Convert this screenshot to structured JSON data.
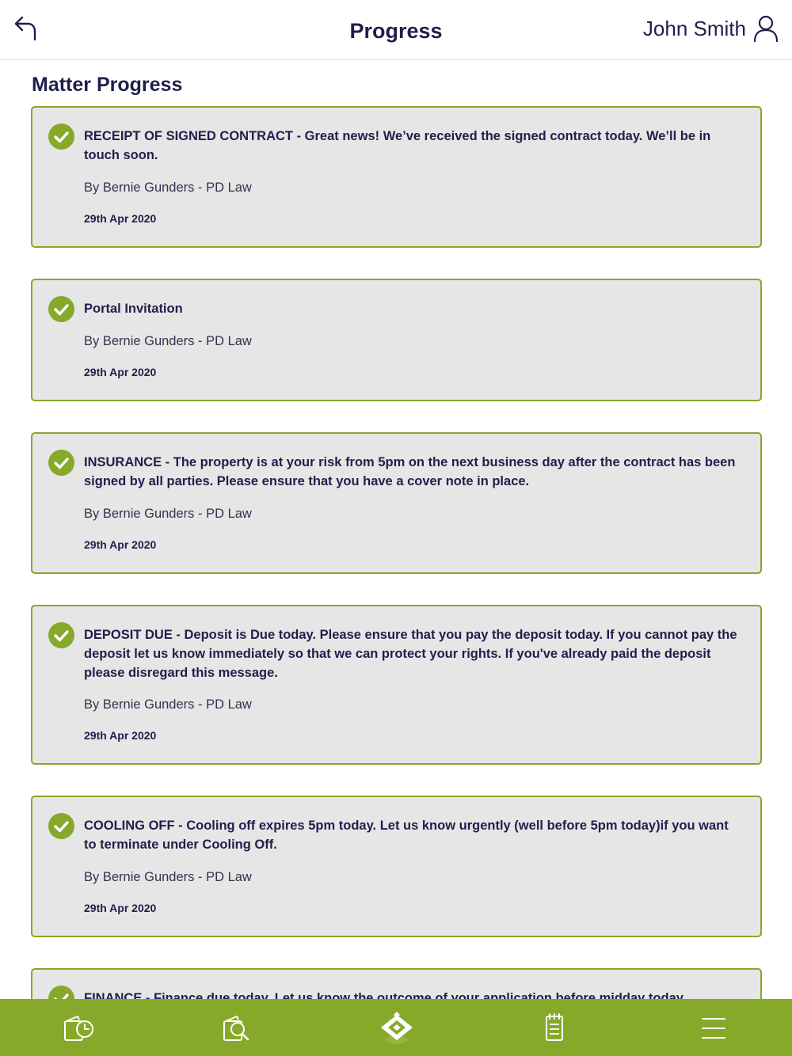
{
  "header": {
    "title": "Progress",
    "user_name": "John Smith",
    "back_icon": "back-arrow-icon",
    "user_icon": "user-icon"
  },
  "section_title": "Matter Progress",
  "colors": {
    "accent": "#86a92a",
    "text": "#1f1f4d",
    "card_bg": "#e6e6e6"
  },
  "progress_items": [
    {
      "text": "RECEIPT OF SIGNED CONTRACT - Great news! We’ve received the signed contract today. We’ll be in touch soon.",
      "author": "By Bernie Gunders - PD Law",
      "date": "29th Apr 2020"
    },
    {
      "text": "Portal Invitation",
      "author": "By Bernie Gunders - PD Law",
      "date": "29th Apr 2020"
    },
    {
      "text": "INSURANCE - The property is at your risk from 5pm on the next business day after the contract has been signed by all parties. Please ensure that you have a cover note in place.",
      "author": "By Bernie Gunders - PD Law",
      "date": "29th Apr 2020"
    },
    {
      "text": "DEPOSIT DUE - Deposit is Due today. Please ensure that you pay the deposit today. If you cannot pay the deposit let us know immediately so that we can protect your rights. If you've already paid the deposit please disregard this message.",
      "author": "By Bernie Gunders - PD Law",
      "date": "29th Apr 2020"
    },
    {
      "text": "COOLING OFF - Cooling off expires 5pm today. Let us know urgently (well before 5pm today)if you want to terminate under Cooling Off.",
      "author": "By Bernie Gunders - PD Law",
      "date": "29th Apr 2020"
    },
    {
      "text": "FINANCE - Finance due today. Let us know the outcome of your application before midday today."
    }
  ],
  "bottom_nav": [
    {
      "icon": "progress-clock-icon"
    },
    {
      "icon": "document-search-icon"
    },
    {
      "icon": "home-logo-icon"
    },
    {
      "icon": "notepad-icon"
    },
    {
      "icon": "menu-icon"
    }
  ]
}
